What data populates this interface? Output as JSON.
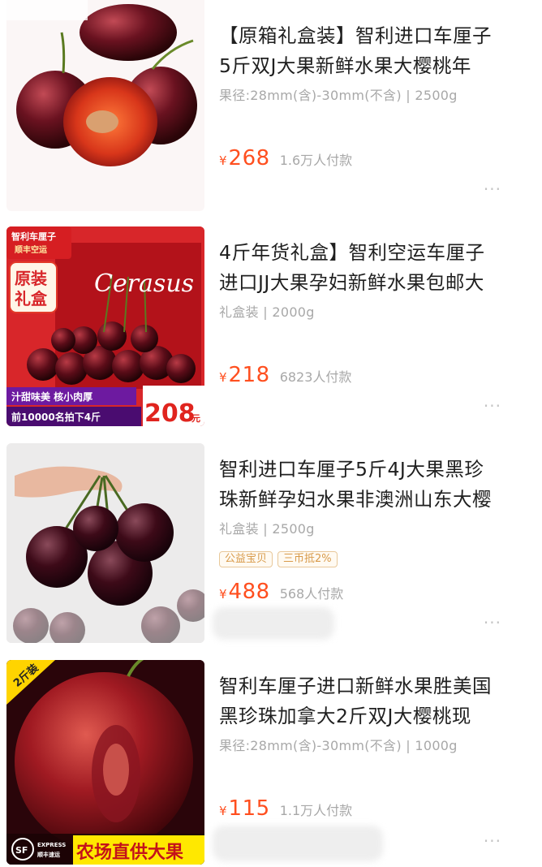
{
  "currency_symbol": "¥",
  "more_icon": "more-dots-icon",
  "products": [
    {
      "title_line1": "【原箱礼盒装】智利进口车厘子",
      "title_line2": "5斤双J大果新鲜水果大樱桃年",
      "spec": "果径:28mm(含)-30mm(不含) | 2500g",
      "price": "268",
      "sold": "1.6万人付款"
    },
    {
      "title_line1": "4斤年货礼盒】智利空运车厘子",
      "title_line2": "进口JJ大果孕妇新鲜水果包邮大",
      "spec": "礼盒装 | 2000g",
      "price": "218",
      "sold": "6823人付款",
      "image_text": {
        "top_badge_1": "智利车厘子",
        "top_badge_2": "顺丰空运",
        "box_label_1": "原装",
        "box_label_2": "礼盒",
        "brand": "Cerasus",
        "promo_line1": "汁甜味美 核小肉厚",
        "promo_line2": "前10000名拍下4斤",
        "promo_price": "208",
        "promo_unit": "元"
      }
    },
    {
      "title_line1": "智利进口车厘子5斤4J大果黑珍",
      "title_line2": "珠新鲜孕妇水果非澳洲山东大樱",
      "spec": "礼盒装 | 2500g",
      "tags": [
        "公益宝贝",
        "三币抵2%"
      ],
      "price": "488",
      "sold": "568人付款"
    },
    {
      "title_line1": "智利车厘子进口新鲜水果胜美国",
      "title_line2": "黑珍珠加拿大2斤双J大樱桃现",
      "spec": "果径:28mm(含)-30mm(不含) | 1000g",
      "price": "115",
      "sold": "1.1万人付款",
      "image_text": {
        "corner_badge": "2斤装",
        "sf_logo": "SF",
        "sf_express": "EXPRESS",
        "sf_cn": "顺丰速运",
        "banner": "农场直供大果"
      }
    }
  ]
}
